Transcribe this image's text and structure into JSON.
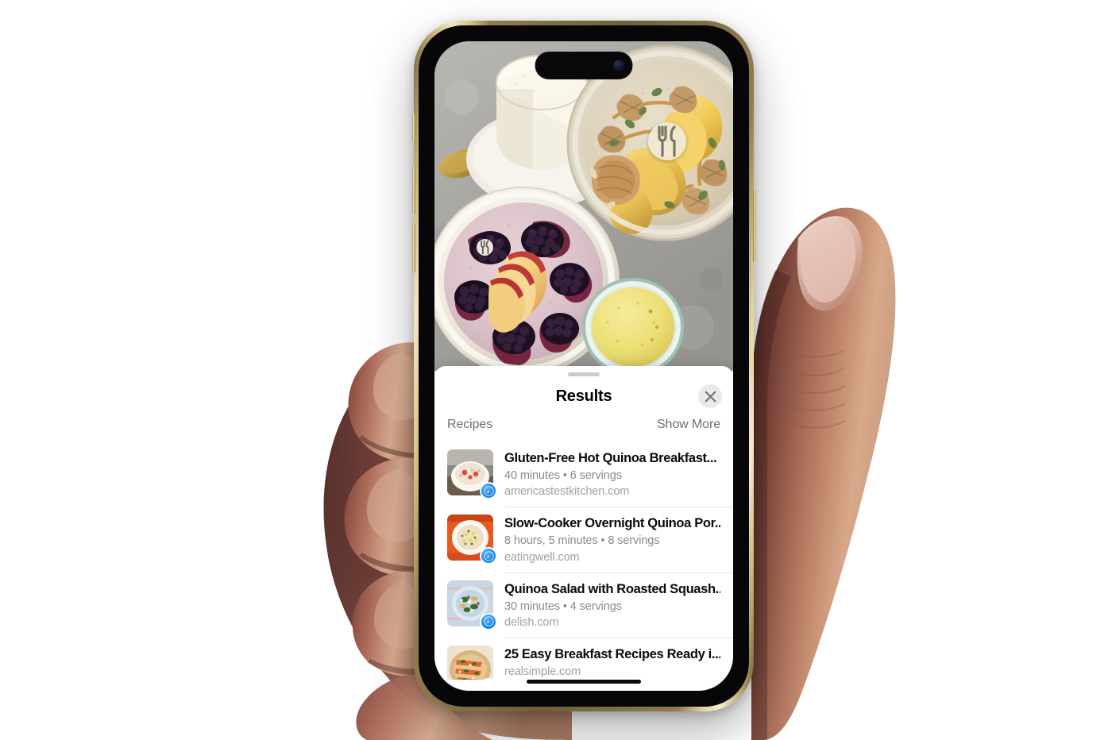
{
  "device": {
    "name": "iPhone",
    "frame_color": "#c9b67e",
    "buttons": [
      "action-button",
      "volume-up",
      "volume-down",
      "power-button"
    ]
  },
  "photo": {
    "description": "Overhead flat-lay of breakfast bowls",
    "visual_look_up_badges": [
      {
        "id": "badge-main",
        "icon": "fork-knife-icon",
        "label": "Look Up Food"
      },
      {
        "id": "badge-small",
        "icon": "fork-knife-icon",
        "label": "Look Up Food"
      }
    ]
  },
  "sheet": {
    "grabber": "drag-handle",
    "title": "Results",
    "close_icon": "close-icon",
    "section": {
      "title": "Recipes",
      "show_more": "Show More"
    }
  },
  "results": [
    {
      "title": "Gluten-Free Hot Quinoa Breakfast...",
      "meta": "40 minutes • 6 servings",
      "domain": "americastestkitchen.com",
      "badge_icon": "safari-icon",
      "thumb": "oatmeal-berries-bowl"
    },
    {
      "title": "Slow-Cooker Overnight Quinoa Por...",
      "meta": "8 hours, 5 minutes • 8 servings",
      "domain": "eatingwell.com",
      "badge_icon": "safari-icon",
      "thumb": "quinoa-porridge-orange-plate"
    },
    {
      "title": "Quinoa Salad with Roasted Squash...",
      "meta": "30 minutes • 4 servings",
      "domain": "delish.com",
      "badge_icon": "safari-icon",
      "thumb": "quinoa-salad-blue-bowl"
    },
    {
      "title": "25 Easy Breakfast Recipes Ready i...",
      "meta": "",
      "domain": "realsimple.com",
      "badge_icon": "safari-icon",
      "thumb": "breakfast-toast-platter"
    }
  ],
  "home_indicator": "home-indicator",
  "colors": {
    "accent": "#2094f3",
    "sheet_bg": "#ffffff",
    "title_text": "#0a0a0a",
    "secondary_text": "#8a8a8e",
    "tertiary_text": "#a0a0a5",
    "separator": "#e3e3e6",
    "close_bg": "#e9e9eb"
  }
}
